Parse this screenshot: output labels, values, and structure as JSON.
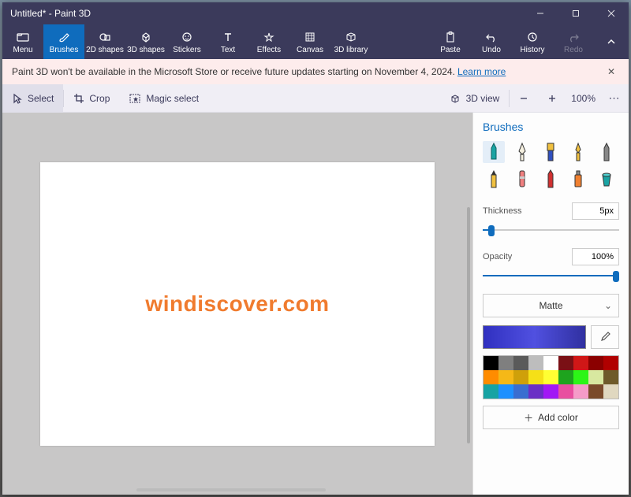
{
  "title": "Untitled* - Paint 3D",
  "ribbon": {
    "menu": "Menu",
    "brushes": "Brushes",
    "shapes2d": "2D shapes",
    "shapes3d": "3D shapes",
    "stickers": "Stickers",
    "text": "Text",
    "effects": "Effects",
    "canvas": "Canvas",
    "library3d": "3D library",
    "paste": "Paste",
    "undo": "Undo",
    "history": "History",
    "redo": "Redo"
  },
  "notif": {
    "text": "Paint 3D won't be available in the Microsoft Store or receive future updates starting on November 4, 2024.",
    "link": "Learn more"
  },
  "toolbar2": {
    "select": "Select",
    "crop": "Crop",
    "magic": "Magic select",
    "view3d": "3D view",
    "zoom": "100%"
  },
  "canvas_text": "windiscover.com",
  "side": {
    "title": "Brushes",
    "thickness_label": "Thickness",
    "thickness_value": "5px",
    "opacity_label": "Opacity",
    "opacity_value": "100%",
    "material": "Matte",
    "addcolor": "Add color"
  },
  "palette": [
    "#000000",
    "#7f7f7f",
    "#bdbdbd",
    "#ffffff",
    "#7a1015",
    "#d01717",
    "#7a3a0a",
    "#ff8c00",
    "#f5d400",
    "#0b5d2e",
    "#17a33a",
    "#0b5d8a",
    "#1e90ff",
    "#3a1e7a",
    "#6a2fc5",
    "#a11e7a",
    "#e84fa0",
    "#7a4a2a",
    "#e87a17",
    "#f5b817",
    "#f5e017",
    "#2cf517",
    "#17f5e0",
    "#177af5",
    "#a117f5",
    "#f517b8",
    "#f5a0c8"
  ],
  "palette_full": [
    "#000000",
    "#7f7f7f",
    "#5a5a5a",
    "#bdbdbd",
    "#ffffff",
    "#7a1015",
    "#d01717",
    "#8b0000",
    "#b00000",
    "#ff8c00",
    "#f5b817",
    "#cfa00a",
    "#f5e017",
    "#ffff33",
    "#1ea31e",
    "#2cf517",
    "#d8e8a0",
    "#6e5a2a",
    "#17a3a3",
    "#1e90ff",
    "#3a6ed0",
    "#6a2fc5",
    "#a117f5",
    "#e84fa0",
    "#f59bc8",
    "#7a4a2a",
    "#e0d8c0"
  ]
}
